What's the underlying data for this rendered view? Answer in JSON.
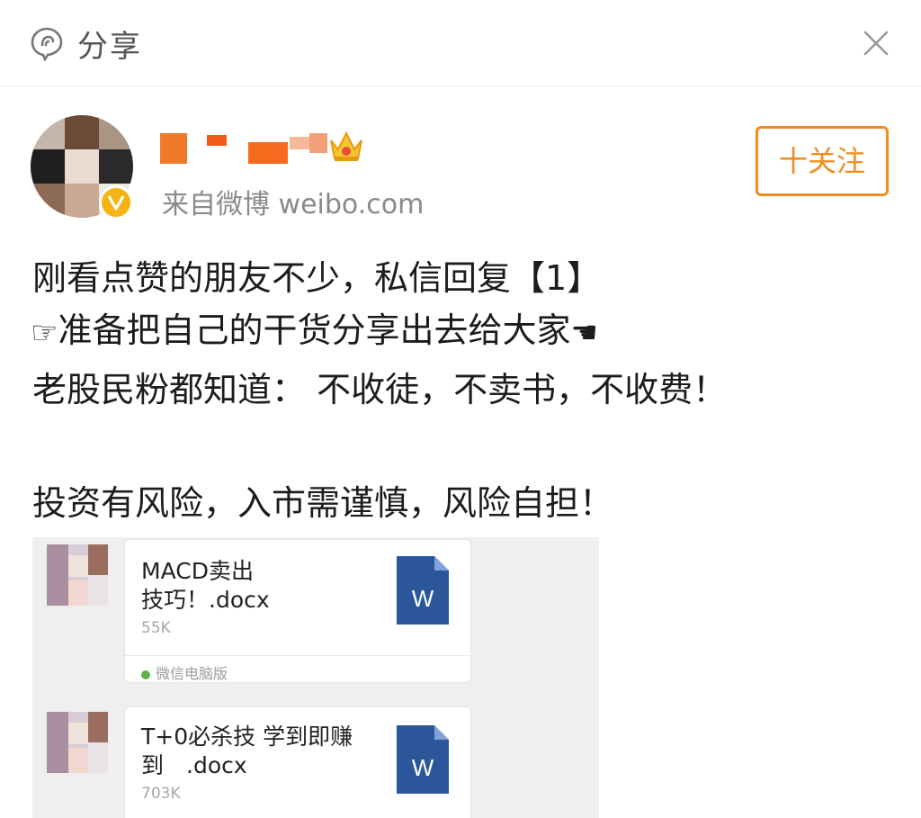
{
  "header": {
    "title": "分享",
    "share_icon": "share-bubble-icon",
    "close_icon": "close-icon"
  },
  "author": {
    "source": "来自微博 weibo.com",
    "follow_label": "十关注",
    "avatar": "avatar-pixelated",
    "verified_badge": "verified-v-icon",
    "crown_icon": "crown-icon"
  },
  "post": {
    "lines": [
      "刚看点赞的朋友不少，私信回复【1】",
      "准备把自己的干货分享出去给大家",
      "老股民粉都知道： 不收徒，不卖书，不收费！",
      "投资有风险，入市需谨慎，风险自担！"
    ],
    "pointing_right_glyph": "☞",
    "pointing_left_glyph": "☚"
  },
  "chat_screenshot": {
    "messages": [
      {
        "file_name_line1": "MACD卖出",
        "file_name_line2": "技巧！.docx",
        "file_size": "55K",
        "file_icon": "word-doc-icon",
        "client": "微信电脑版"
      },
      {
        "file_name_line1": "T+0必杀技 学到即赚",
        "file_name_line2": "到　.docx",
        "file_size": "703K",
        "file_icon": "word-doc-icon"
      }
    ]
  },
  "colors": {
    "accent_orange": "#f08d1e",
    "verified_gold": "#f5b414",
    "word_blue": "#2b579a",
    "muted_gray": "#8a8a8a"
  }
}
